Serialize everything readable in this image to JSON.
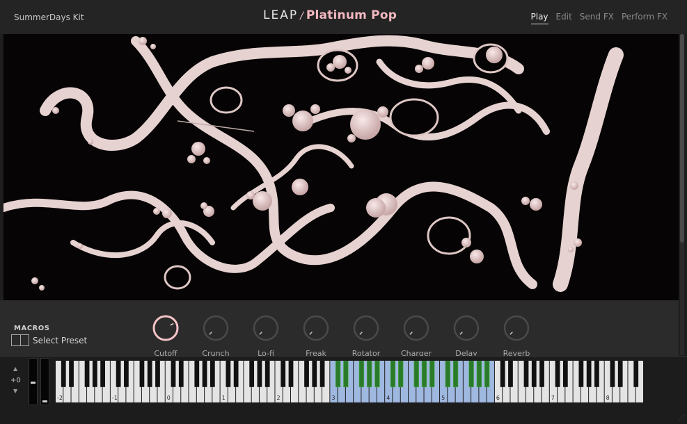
{
  "header": {
    "kit_name": "SummerDays Kit",
    "logo_leap": "LEAP",
    "logo_name": "Platinum Pop",
    "nav": [
      {
        "label": "Play",
        "active": true
      },
      {
        "label": "Edit",
        "active": false
      },
      {
        "label": "Send FX",
        "active": false
      },
      {
        "label": "Perform FX",
        "active": false
      }
    ]
  },
  "macros": {
    "title": "MACROS",
    "preset_label": "Select Preset",
    "knobs": [
      {
        "label": "Cutoff",
        "value": 0.72,
        "active": true
      },
      {
        "label": "Crunch",
        "value": 0.0,
        "active": false
      },
      {
        "label": "Lo-fi",
        "value": 0.0,
        "active": false
      },
      {
        "label": "Freak",
        "value": 0.0,
        "active": false
      },
      {
        "label": "Rotator",
        "value": 0.0,
        "active": false
      },
      {
        "label": "Charger",
        "value": 0.0,
        "active": false
      },
      {
        "label": "Delay",
        "value": 0.0,
        "active": false
      },
      {
        "label": "Reverb",
        "value": 0.0,
        "active": false
      }
    ]
  },
  "keyboard": {
    "octave_up": "▲",
    "octave_down": "▼",
    "octave_shift": "+0",
    "octave_labels": [
      "-2",
      "-1",
      "0",
      "1",
      "2",
      "3",
      "4",
      "5",
      "6",
      "7",
      "8"
    ],
    "mapped_range": {
      "from_octave": 3,
      "to_octave": 5
    },
    "colors": {
      "mapped_white": "#9fb8e0",
      "mapped_black": "#2a7a2a",
      "mapped_border": "#4ab04a"
    }
  },
  "colors": {
    "accent": "#f2b8c0",
    "knob_active": "#f4c4c8",
    "knob_idle": "#4a4a4a"
  }
}
